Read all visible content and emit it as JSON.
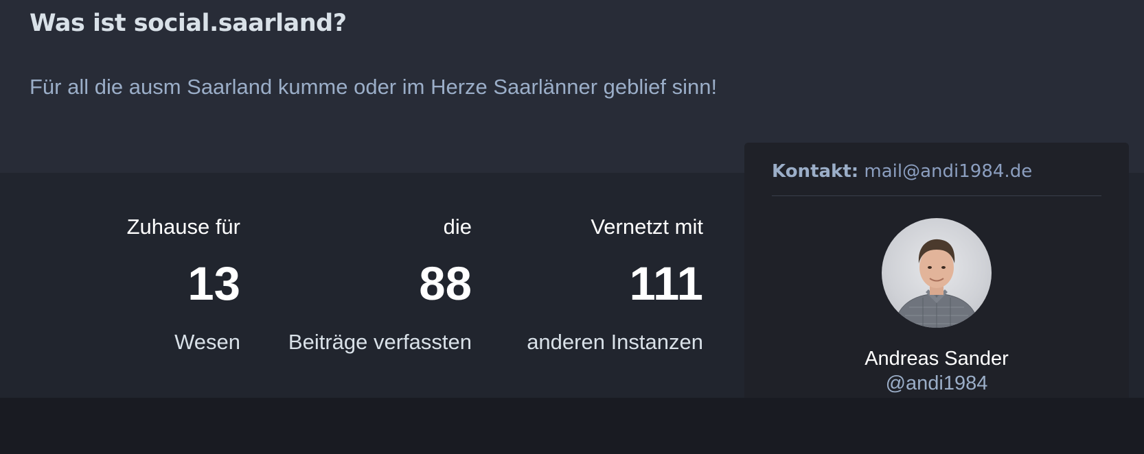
{
  "hero": {
    "title": "Was ist social.saarland?",
    "tagline": "Für all die ausm Saarland kumme oder im Herze Saarlänner geblief sinn!"
  },
  "stats": {
    "users": {
      "lead": "Zuhause für",
      "value": "13",
      "tail": "Wesen"
    },
    "posts": {
      "lead": "die",
      "value": "88",
      "tail": "Beiträge verfassten"
    },
    "instances": {
      "lead": "Vernetzt mit",
      "value": "111",
      "tail": "anderen Instanzen"
    }
  },
  "contact": {
    "label": "Kontakt:",
    "email": "mail@andi1984.de",
    "name": "Andreas Sander",
    "handle": "@andi1984"
  },
  "colors": {
    "hero_bg": "#282c37",
    "stats_bg": "#21252e",
    "page_bg": "#191b22",
    "accent": "#9baec8"
  }
}
